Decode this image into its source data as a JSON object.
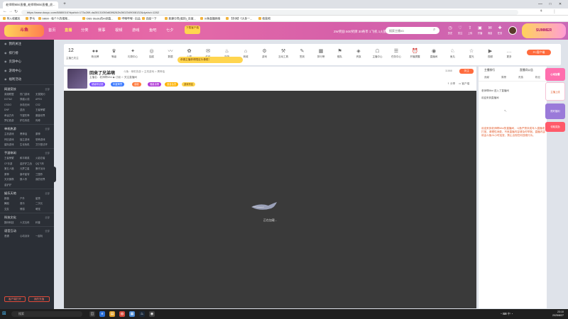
{
  "browser": {
    "tabs": [
      {
        "label": "老师啊Mini直播_老师啊Mini直播_虎..."
      }
    ],
    "url": "https://www.douyu.com/8880016?dyshid=173c269-da28131050d63f6262b2602349008132&dyshci=1282",
    "bookmarks": [
      "导入收藏夹",
      "罗马",
      "bilibili - 每个人的视频...",
      "OBS Studio的AI创造...",
      "哔哩哔哩 - 出品",
      "百度一下",
      "新建分类(我的)_百度...",
      "斗鱼直播网络",
      "【外网】《大多一...",
      "收获吧"
    ],
    "controls": {
      "minimize": "—",
      "maximize": "□",
      "close": "✕"
    }
  },
  "header": {
    "logo": "斗鱼",
    "nav": [
      "首页",
      "直播",
      "分类",
      "赛事",
      "视频",
      "游戏",
      "鱼吧",
      "七夕"
    ],
    "nav_active_index": 1,
    "download_badge": "下载客户端",
    "banner_text": "2W奖励   500奖牌   30奇币   1飞机   1火箭",
    "search_placeholder": "搜索主播/ID",
    "icons": [
      {
        "name": "history-icon",
        "glyph": "◷",
        "label": "历史"
      },
      {
        "name": "follow-icon",
        "glyph": "♡",
        "label": "关注"
      },
      {
        "name": "upload-icon",
        "glyph": "⇧",
        "label": "上传"
      },
      {
        "name": "record-icon",
        "glyph": "▣",
        "label": "开播"
      },
      {
        "name": "notice-icon",
        "glyph": "✉",
        "label": "消息"
      },
      {
        "name": "task-icon",
        "glyph": "✚",
        "label": "任务"
      }
    ],
    "deco_right": "SUMMER"
  },
  "sidebar": {
    "top_items": [
      "我的关注",
      "排行榜",
      "页游中心",
      "游戏中心",
      "福利活动"
    ],
    "sections": [
      {
        "title": "网游竞技",
        "more": "全部",
        "items": [
          "英雄联盟",
          "热门游戏",
          "无畏契约",
          "DOTA2",
          "穿越火线",
          "APEX",
          "CSGO",
          "永劫无间",
          "CS2",
          "DNF",
          "逆战",
          "王者荣耀",
          "命运方舟",
          "守望先锋",
          "魔兽世界",
          "梦幻西游",
          "炉石传说",
          "传奇"
        ]
      },
      {
        "title": "单机热游",
        "more": "全部",
        "items": [
          "主机游戏",
          "黑神话",
          "原神",
          "怀旧游戏",
          "独立游戏",
          "恐怖游戏",
          "星际游戏",
          "生化危机",
          "艾尔登法环"
        ]
      },
      {
        "title": "手游休闲",
        "more": "全部",
        "items": [
          "王者荣耀",
          "和平精英",
          "火影忍者",
          "CF手游",
          "金铲铲之战",
          "QQ飞车",
          "第五人格",
          "元梦之星",
          "蛋仔派对",
          "原神",
          "崩坏星穹",
          "三国杀",
          "天天象棋",
          "狼人杀",
          "我的世界",
          "金铲铲"
        ]
      },
      {
        "title": "娱乐天地",
        "more": "全部",
        "items": [
          "颜值",
          "户外",
          "星秀",
          "舞蹈",
          "音乐",
          "二次元",
          "交友",
          "情感",
          "萌宠"
        ]
      },
      {
        "title": "科技文化",
        "more": "全部",
        "items": [
          "数码科技",
          "人文社科",
          "科普"
        ]
      },
      {
        "title": "语音互动",
        "more": "全部",
        "items": [
          "音遇",
          "心动派对",
          "一起玩"
        ]
      }
    ],
    "bottom_buttons": [
      "客户端打开",
      "我的充值"
    ]
  },
  "category_bar": {
    "fav_count": "12",
    "fav_label": "主播已关注",
    "items": [
      {
        "name": "fan-icon",
        "glyph": "●●",
        "label": "粉丝牌"
      },
      {
        "name": "level-icon",
        "glyph": "♛",
        "label": "等级"
      },
      {
        "name": "gift-icon",
        "glyph": "✦",
        "label": "礼物中心"
      },
      {
        "name": "lottery-icon",
        "glyph": "◎",
        "label": "抽奖"
      },
      {
        "name": "chart-icon",
        "glyph": "〰",
        "label": "数据"
      },
      {
        "name": "wish-icon",
        "glyph": "✿",
        "label": "心愿"
      },
      {
        "name": "redpack-icon",
        "glyph": "✉",
        "label": "红包"
      },
      {
        "name": "guard-icon",
        "glyph": "♨",
        "label": "守护"
      },
      {
        "name": "shop-icon",
        "glyph": "⌂",
        "label": "商城"
      },
      {
        "name": "game-icon",
        "glyph": "⚙",
        "label": "游戏"
      },
      {
        "name": "tools-icon",
        "glyph": "⚒",
        "label": "互动工具"
      },
      {
        "name": "sign-icon",
        "glyph": "✎",
        "label": "签到"
      },
      {
        "name": "rank-icon",
        "glyph": "▦",
        "label": "排行榜"
      },
      {
        "name": "fleet-icon",
        "glyph": "⚑",
        "label": "舰队"
      },
      {
        "name": "vip-icon",
        "glyph": "◈",
        "label": "贵族"
      },
      {
        "name": "noble-icon",
        "glyph": "☖",
        "label": "主播中心"
      },
      {
        "name": "tasks-icon",
        "glyph": "☰",
        "label": "任务中心"
      },
      {
        "name": "alarm-icon",
        "glyph": "⏰",
        "label": "开播提醒"
      },
      {
        "name": "live-icon",
        "glyph": "◉",
        "label": "直播间"
      },
      {
        "name": "pet-icon",
        "glyph": "♘",
        "label": "鱼丸"
      },
      {
        "name": "star-icon",
        "glyph": "☆",
        "label": "星光"
      },
      {
        "name": "video-icon",
        "glyph": "▶",
        "label": "视频"
      },
      {
        "name": "more-icon",
        "glyph": "…",
        "label": "更多"
      }
    ],
    "promo_tip": "恭喜主播获得限定头像框！",
    "pc_client": "PC客户端"
  },
  "room": {
    "title": "回来了兄弟萌",
    "subtitle": "斗鱼  · 单机热游 > 主机游戏 > 黑神话",
    "meta": "主播名：老师啊Mini   ◆ 订阅   ☆ 关注直播间",
    "tags": [
      {
        "label": "超级粉丝团",
        "color": "#7b4dff"
      },
      {
        "label": "年度荣誉",
        "color": "#3d7bff"
      },
      {
        "label": "高能",
        "color": "#ff7b3d"
      },
      {
        "label": "福星高照",
        "color": "#b03ad6"
      },
      {
        "label": "蓝金会员",
        "color": "#ffb300"
      },
      {
        "label": "游戏专区",
        "color": "#ffd54f"
      }
    ],
    "room_id": "11868",
    "follow": "关注",
    "share": "分享",
    "client_watch": "客户端"
  },
  "video": {
    "loading": "正在加载..."
  },
  "chat": {
    "tabs": [
      "主播排行",
      "直播间公告"
    ],
    "rank_tabs": [
      "贡献",
      "周榜",
      "贵族",
      "粉丝"
    ],
    "lines": [
      "老师啊Mini 进入了直播间",
      "欢迎来到直播间"
    ],
    "notice": "欢迎来到老师啊Mini的直播间，斗鱼严禁未成年人直播或打赏，请理性消费，不良直播内容请及时举报。直播内容将由斗鱼24小时巡查，禁止出现任何违规行为。"
  },
  "promo_strip": {
    "cards": [
      "心动加餐",
      "主播上线",
      "限时福利",
      "领取奖励"
    ]
  },
  "taskbar": {
    "search": "搜索",
    "tray": "^  ⌨  中  ◔",
    "time": "23:10",
    "date": "2025/8/27"
  }
}
